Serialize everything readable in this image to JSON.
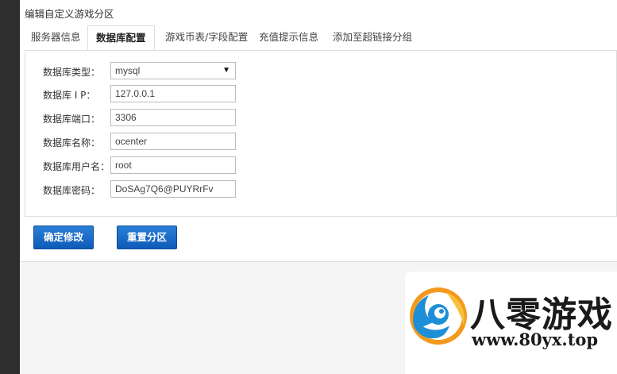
{
  "page": {
    "title": "编辑自定义游戏分区"
  },
  "tabs": [
    {
      "label": "服务器信息",
      "active": false
    },
    {
      "label": "数据库配置",
      "active": true
    },
    {
      "label": "游戏币表/字段配置",
      "active": false
    },
    {
      "label": "充值提示信息",
      "active": false
    },
    {
      "label": "添加至超链接分组",
      "active": false
    }
  ],
  "form": {
    "db_type": {
      "label": "数据库类型：",
      "value": "mysql"
    },
    "db_ip": {
      "label": "数据库 I P：",
      "value": "127.0.0.1"
    },
    "db_port": {
      "label": "数据库端口：",
      "value": "3306"
    },
    "db_name": {
      "label": "数据库名称：",
      "value": "ocenter"
    },
    "db_user": {
      "label": "数据库用户名：",
      "value": "root"
    },
    "db_password": {
      "label": "数据库密码：",
      "value": "DoSAg7Q6@PUYRrFv"
    }
  },
  "buttons": {
    "confirm": "确定修改",
    "reset": "重置分区"
  },
  "watermark": {
    "brand": "八零游戏",
    "url": "www.80yx.top"
  },
  "colors": {
    "button_blue": "#1a6cc8",
    "sidebar": "#2e2e2e",
    "logo_orange": "#f39a1e",
    "logo_blue": "#1e8fd6"
  }
}
